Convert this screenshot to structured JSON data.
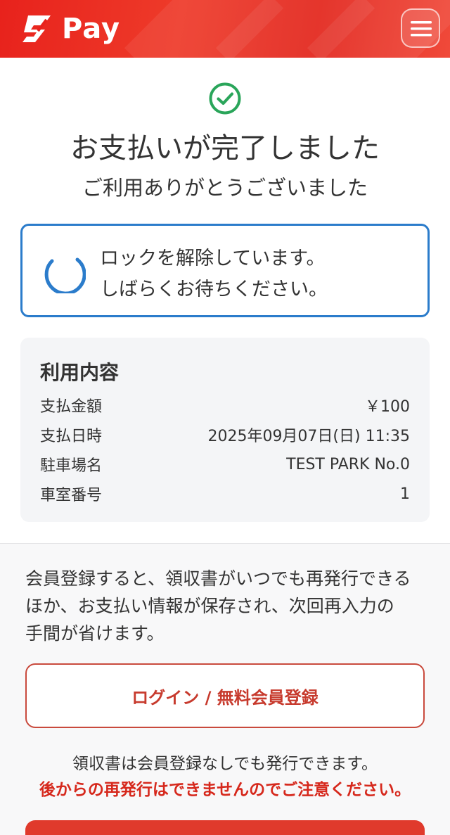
{
  "header": {
    "logo_text": "Pay",
    "logo_icon": "s-pay-logo-icon",
    "menu_icon": "hamburger-menu-icon",
    "brand_color": "#e8221c"
  },
  "success": {
    "icon": "check-circle-icon",
    "title": "お支払いが完了しました",
    "subtitle": "ご利用ありがとうございました",
    "icon_color": "#2aa55a"
  },
  "unlock": {
    "icon": "loading-spinner-icon",
    "line1": "ロックを解除しています。",
    "line2": "しばらくお待ちください。",
    "accent_color": "#2b7ccb"
  },
  "details": {
    "title": "利用内容",
    "rows": [
      {
        "label": "支払金額",
        "value": "￥100"
      },
      {
        "label": "支払日時",
        "value": "2025年09月07日(日) 11:35"
      },
      {
        "label": "駐車場名",
        "value": "TEST PARK No.0"
      },
      {
        "label": "車室番号",
        "value": "1"
      }
    ]
  },
  "member": {
    "line1": "会員登録すると、領収書がいつでも再発行できる",
    "line2": "ほか、お支払い情報が保存され、次回再入力の",
    "line3": "手間が省けます。",
    "login_button": "ログイン / 無料会員登録",
    "receipt_note": "領収書は会員登録なしでも発行できます。",
    "receipt_warning": "後からの再発行はできませんのでご注意ください。",
    "warning_color": "#d6281c"
  }
}
